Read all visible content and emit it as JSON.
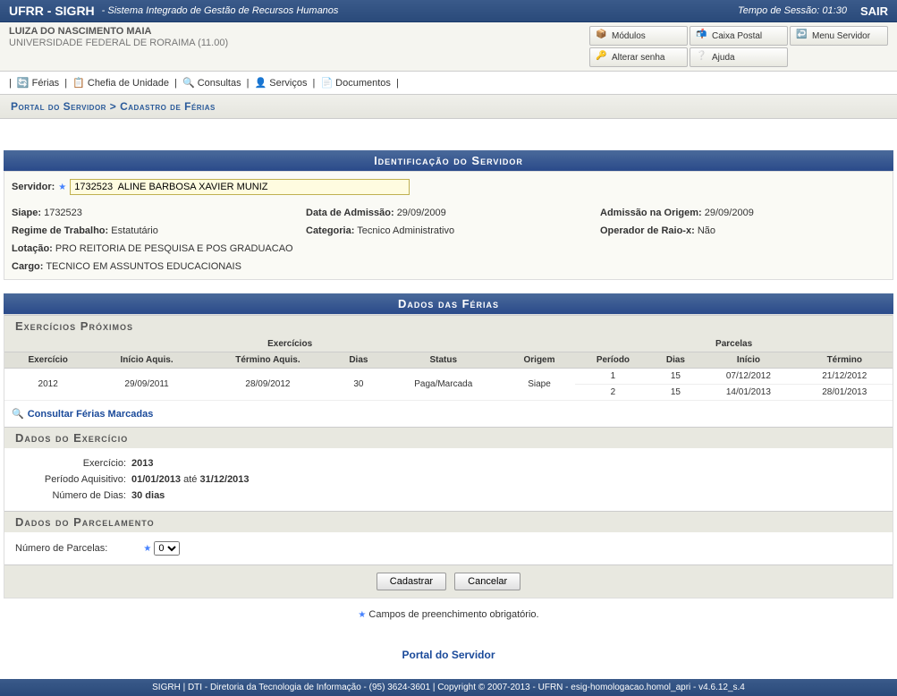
{
  "header": {
    "title": "UFRR - SIGRH",
    "subtitle": "- Sistema Integrado de Gestão de Recursos Humanos",
    "session": "Tempo de Sessão: 01:30",
    "logout": "SAIR"
  },
  "user": {
    "name": "LUIZA DO NASCIMENTO MAIA",
    "institution": "UNIVERSIDADE FEDERAL DE RORAIMA (11.00)"
  },
  "topbtns": {
    "modulos": "Módulos",
    "caixa": "Caixa Postal",
    "menu": "Menu Servidor",
    "alterar": "Alterar senha",
    "ajuda": "Ajuda"
  },
  "menu": {
    "ferias": "Férias",
    "chefia": "Chefia de Unidade",
    "consultas": "Consultas",
    "servicos": "Serviços",
    "documentos": "Documentos"
  },
  "breadcrumb": "Portal do Servidor > Cadastro de Férias",
  "sec1": {
    "title": "Identificação do Servidor",
    "servidor_label": "Servidor:",
    "servidor_value": "1732523  ALINE BARBOSA XAVIER MUNIZ",
    "siape_label": "Siape:",
    "siape_value": "1732523",
    "admissao_label": "Data de Admissão:",
    "admissao_value": "29/09/2009",
    "origem_label": "Admissão na Origem:",
    "origem_value": "29/09/2009",
    "regime_label": "Regime de Trabalho:",
    "regime_value": "Estatutário",
    "categoria_label": "Categoria:",
    "categoria_value": "Tecnico Administrativo",
    "raiox_label": "Operador de Raio-x:",
    "raiox_value": "Não",
    "lotacao_label": "Lotação:",
    "lotacao_value": "PRO REITORIA DE PESQUISA E POS GRADUACAO",
    "cargo_label": "Cargo:",
    "cargo_value": "TECNICO EM ASSUNTOS EDUCACIONAIS"
  },
  "sec2": {
    "title": "Dados das Férias",
    "sub1": "Exercícios Próximos",
    "headers": {
      "exercicios_group": "Exercícios",
      "parcelas_group": "Parcelas",
      "exercicio": "Exercício",
      "inicio_aquis": "Início Aquis.",
      "termino_aquis": "Término Aquis.",
      "dias": "Dias",
      "status": "Status",
      "origem": "Origem",
      "periodo": "Período",
      "pdias": "Dias",
      "inicio": "Início",
      "termino": "Término"
    },
    "row": {
      "exercicio": "2012",
      "inicio_aquis": "29/09/2011",
      "termino_aquis": "28/09/2012",
      "dias": "30",
      "status": "Paga/Marcada",
      "origem": "Siape"
    },
    "parcelas": [
      {
        "periodo": "1",
        "dias": "15",
        "inicio": "07/12/2012",
        "termino": "21/12/2012"
      },
      {
        "periodo": "2",
        "dias": "15",
        "inicio": "14/01/2013",
        "termino": "28/01/2013"
      }
    ],
    "link": "Consultar Férias Marcadas",
    "sub2": "Dados do Exercício",
    "ex_label": "Exercício:",
    "ex_value": "2013",
    "periodo_label": "Período Aquisitivo:",
    "periodo_start": "01/01/2013",
    "ate": "até",
    "periodo_end": "31/12/2013",
    "numdias_label": "Número de Dias:",
    "numdias_value": "30 dias",
    "sub3": "Dados do Parcelamento",
    "numparc_label": "Número de Parcelas:",
    "numparc_value": "0"
  },
  "buttons": {
    "cadastrar": "Cadastrar",
    "cancelar": "Cancelar"
  },
  "note": "Campos de preenchimento obrigatório.",
  "portal": "Portal do Servidor",
  "footer": "SIGRH | DTI - Diretoria da Tecnologia de Informação - (95) 3624-3601 | Copyright © 2007-2013 - UFRN - esig-homologacao.homol_apri - v4.6.12_s.4"
}
